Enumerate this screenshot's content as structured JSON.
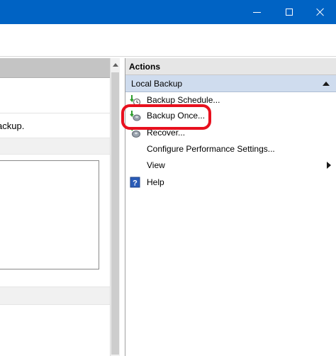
{
  "window": {
    "controls": [
      "minimize-icon",
      "maximize-icon",
      "close-icon"
    ]
  },
  "left_pane": {
    "partial_text": "ackup."
  },
  "actions_pane": {
    "header": "Actions",
    "section": "Local Backup",
    "items": [
      {
        "label": "Backup Schedule...",
        "icon": "backup-schedule-icon"
      },
      {
        "label": "Backup Once...",
        "icon": "backup-once-icon"
      },
      {
        "label": "Recover...",
        "icon": "recover-icon"
      },
      {
        "label": "Configure Performance Settings...",
        "icon": ""
      },
      {
        "label": "View",
        "icon": "",
        "submenu": true
      },
      {
        "label": "Help",
        "icon": "help-icon"
      }
    ]
  },
  "colors": {
    "titlebar": "#0063c4",
    "section_header": "#cfdcee",
    "highlight": "#e8101e"
  }
}
